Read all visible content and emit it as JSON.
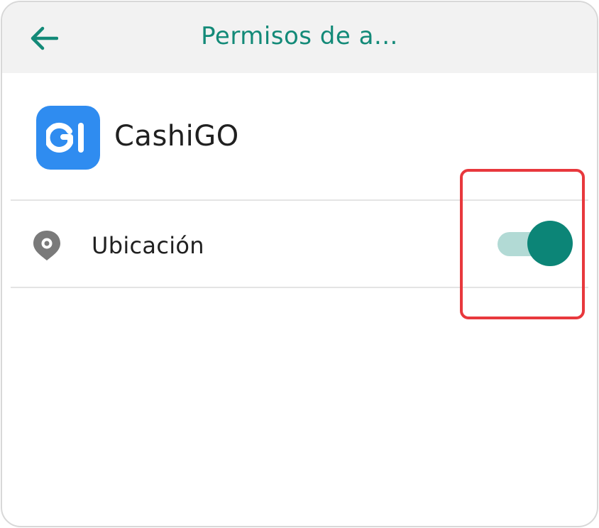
{
  "header": {
    "title": "Permisos de a...",
    "back_icon": "arrow-left-icon"
  },
  "app": {
    "name": "CashiGO",
    "icon": "cashigo-logo-icon",
    "icon_color": "#2f8cf0"
  },
  "permissions": [
    {
      "label": "Ubicación",
      "icon": "location-pin-icon",
      "enabled": true
    }
  ],
  "colors": {
    "accent": "#138a78",
    "toggle_thumb": "#0c8577",
    "toggle_track": "#b2dad5",
    "highlight": "#e8383d",
    "header_bg": "#f2f2f2"
  }
}
